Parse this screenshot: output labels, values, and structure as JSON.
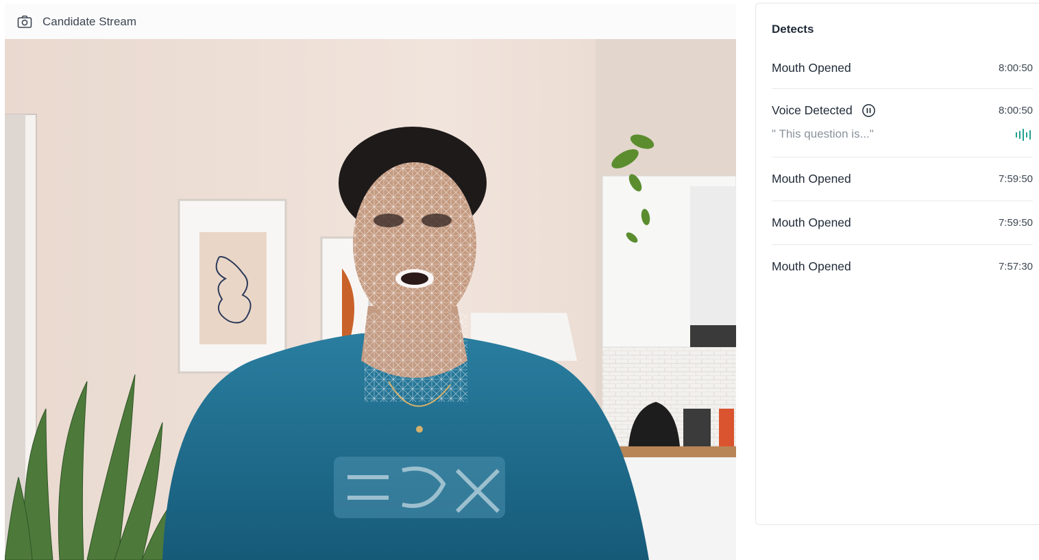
{
  "stream": {
    "title": "Candidate Stream",
    "icon": "camera-icon"
  },
  "detects": {
    "title": "Detects",
    "items": [
      {
        "label": "Mouth Opened",
        "time": "8:00:50"
      },
      {
        "label": "Voice Detected",
        "time": "8:00:50",
        "quote": "\" This question is...\"",
        "icon": "pause-circle-icon",
        "audio_icon": "audio-wave-icon"
      },
      {
        "label": "Mouth Opened",
        "time": "7:59:50"
      },
      {
        "label": "Mouth Opened",
        "time": "7:59:50"
      },
      {
        "label": "Mouth Opened",
        "time": "7:57:30"
      }
    ]
  },
  "colors": {
    "accent_wave": "#1fa08f",
    "shirt": "#1f6c8c",
    "wall": "#eedfd6"
  }
}
